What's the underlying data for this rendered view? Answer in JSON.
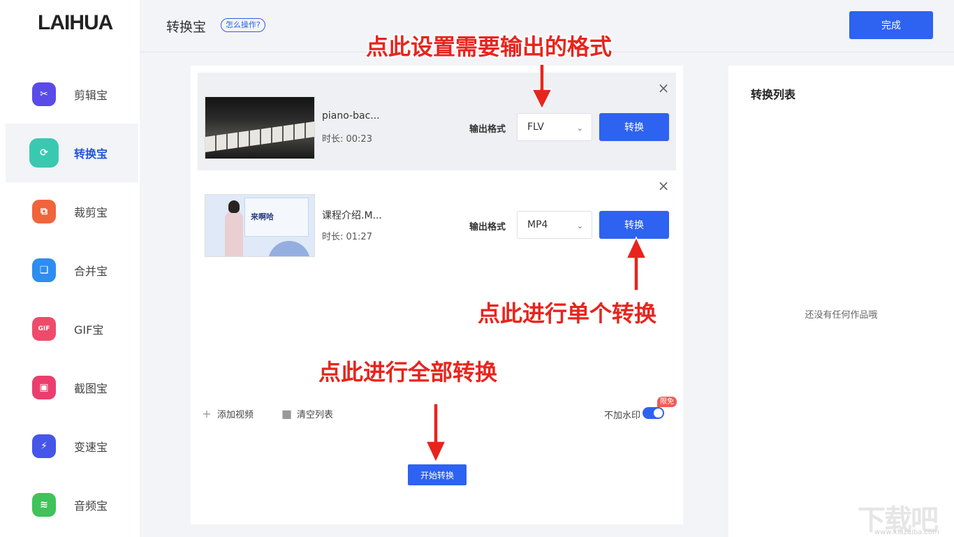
{
  "app": {
    "logo": "LAIHUA"
  },
  "sidebar": {
    "items": [
      {
        "label": "剪辑宝",
        "icon": "scissors-icon",
        "glyph": "✂",
        "color": "#5a4be8",
        "active": false
      },
      {
        "label": "转换宝",
        "icon": "convert-icon",
        "glyph": "⟳",
        "color": "#39c9b0",
        "active": true
      },
      {
        "label": "裁剪宝",
        "icon": "crop-icon",
        "glyph": "⧉",
        "color": "#f0643c",
        "active": false
      },
      {
        "label": "合并宝",
        "icon": "merge-icon",
        "glyph": "❏",
        "color": "#2d8df0",
        "active": false
      },
      {
        "label": "GIF宝",
        "icon": "gif-icon",
        "glyph": "GIF",
        "color": "#f04a6a",
        "active": false
      },
      {
        "label": "截图宝",
        "icon": "screenshot-icon",
        "glyph": "▣",
        "color": "#ec3e6e",
        "active": false
      },
      {
        "label": "变速宝",
        "icon": "lightning-icon",
        "glyph": "⚡",
        "color": "#4656e8",
        "active": false
      },
      {
        "label": "音频宝",
        "icon": "audio-wave-icon",
        "glyph": "≋",
        "color": "#3fc35a",
        "active": false
      }
    ]
  },
  "header": {
    "title": "转换宝",
    "help": "怎么操作?",
    "done": "完成"
  },
  "videos": [
    {
      "name": "piano-bac...",
      "duration": "时长: 00:23",
      "format_label": "输出格式",
      "format": "FLV",
      "convert": "转换"
    },
    {
      "name": "课程介绍.M...",
      "duration": "时长: 01:27",
      "format_label": "输出格式",
      "format": "MP4",
      "convert": "转换",
      "thumb_text": "来啊哈"
    }
  ],
  "toolbar": {
    "add": "添加视频",
    "clear": "清空列表",
    "watermark": "不加水印",
    "badge": "限免",
    "watermark_on": true
  },
  "start_button": "开始转换",
  "right_panel": {
    "title": "转换列表",
    "empty": "还没有任何作品哦"
  },
  "annotations": {
    "format": "点此设置需要输出的格式",
    "single": "点此进行单个转换",
    "all": "点此进行全部转换"
  },
  "watermark_site": {
    "mark": "下载吧",
    "url": "www.xiazaiba.com"
  },
  "colors": {
    "accent": "#2e62f0",
    "annotation": "#e8241c",
    "active_nav": "#2156d8"
  }
}
